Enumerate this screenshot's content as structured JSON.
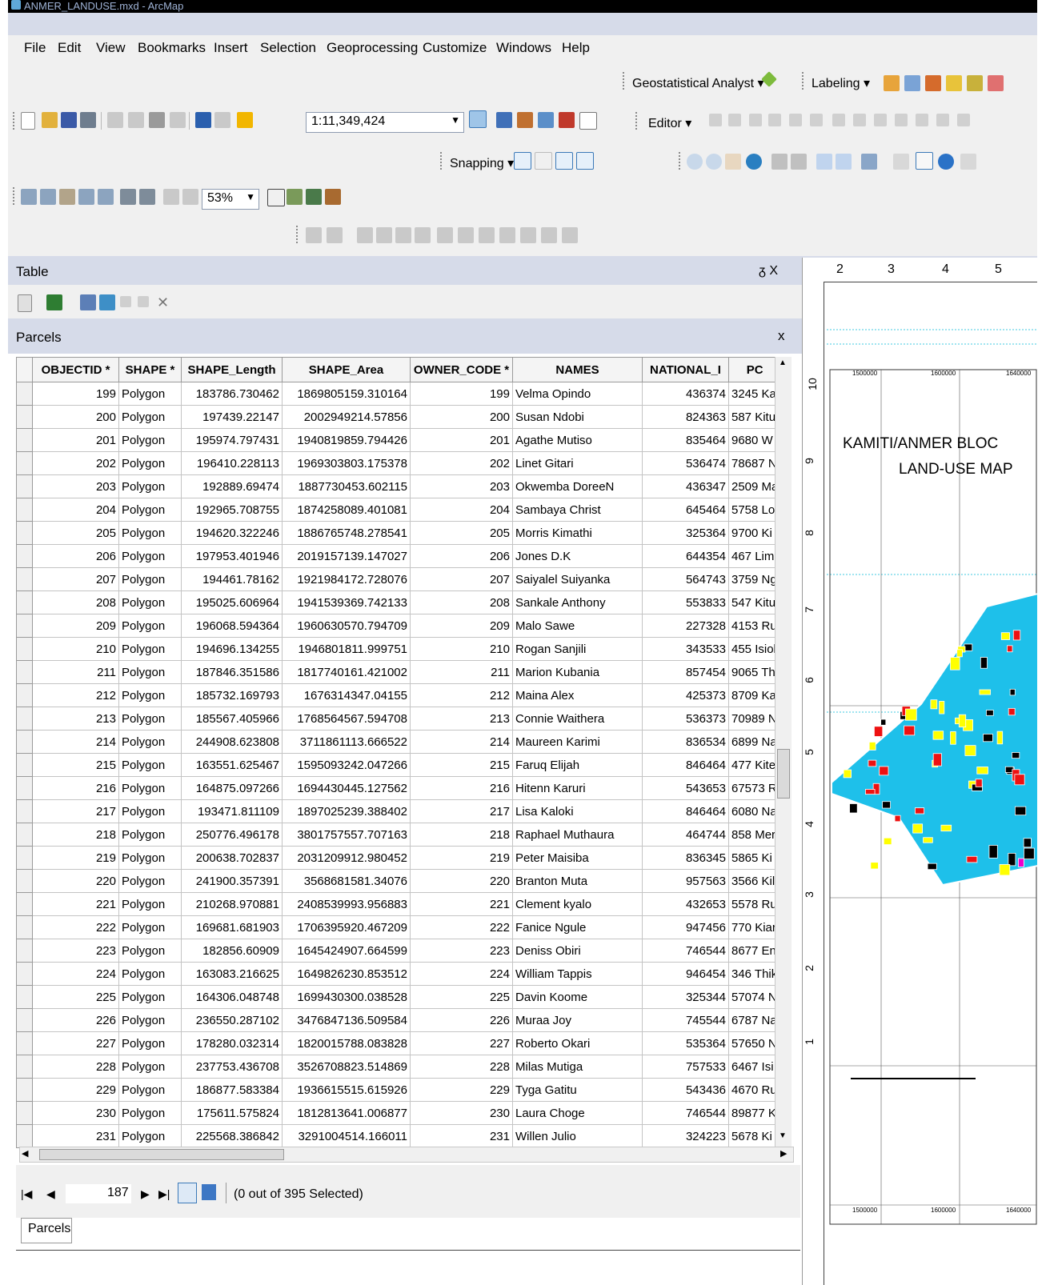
{
  "window": {
    "title": "ANMER_LANDUSE.mxd - ArcMap"
  },
  "menu": [
    "File",
    "Edit",
    "View",
    "Bookmarks",
    "Insert",
    "Selection",
    "Geoprocessing",
    "Customize",
    "Windows",
    "Help"
  ],
  "toolbars": {
    "geostat_label": "Geostatistical Analyst ▾",
    "labeling_label": "Labeling ▾",
    "scale_value": "1:11,349,424",
    "editor_label": "Editor ▾",
    "snapping_label": "Snapping ▾",
    "layout_zoom": "53%"
  },
  "table_panel": {
    "title": "Table",
    "pin": "ᵹ X",
    "tab_title": "Parcels",
    "close": "x"
  },
  "columns": [
    "",
    "OBJECTID *",
    "SHAPE *",
    "SHAPE_Length",
    "SHAPE_Area",
    "OWNER_CODE *",
    "NAMES",
    "NATIONAL_I",
    "PC"
  ],
  "rows": [
    [
      "199",
      "Polygon",
      "183786.730462",
      "1869805159.310164",
      "199",
      "Velma Opindo",
      "436374",
      "3245 Ka"
    ],
    [
      "200",
      "Polygon",
      "197439.22147",
      "2002949214.57856",
      "200",
      "Susan Ndobi",
      "824363",
      "587 Kitu"
    ],
    [
      "201",
      "Polygon",
      "195974.797431",
      "1940819859.794426",
      "201",
      "Agathe Mutiso",
      "835464",
      "9680 W"
    ],
    [
      "202",
      "Polygon",
      "196410.228113",
      "1969303803.175378",
      "202",
      "Linet Gitari",
      "536474",
      "78687 N"
    ],
    [
      "203",
      "Polygon",
      "192889.69474",
      "1887730453.602115",
      "203",
      "Okwemba DoreeN",
      "436347",
      "2509 Ma"
    ],
    [
      "204",
      "Polygon",
      "192965.708755",
      "1874258089.401081",
      "204",
      "Sambaya Christ",
      "645464",
      "5758 Lo"
    ],
    [
      "205",
      "Polygon",
      "194620.322246",
      "1886765748.278541",
      "205",
      "Morris Kimathi",
      "325364",
      "9700 Ki"
    ],
    [
      "206",
      "Polygon",
      "197953.401946",
      "2019157139.147027",
      "206",
      "Jones D.K",
      "644354",
      "467 Lim"
    ],
    [
      "207",
      "Polygon",
      "194461.78162",
      "1921984172.728076",
      "207",
      "Saiyalel Suiyanka",
      "564743",
      "3759 Ng"
    ],
    [
      "208",
      "Polygon",
      "195025.606964",
      "1941539369.742133",
      "208",
      "Sankale Anthony",
      "553833",
      "547 Kitu"
    ],
    [
      "209",
      "Polygon",
      "196068.594364",
      "1960630570.794709",
      "209",
      "Malo Sawe",
      "227328",
      "4153 Ru"
    ],
    [
      "210",
      "Polygon",
      "194696.134255",
      "1946801811.999751",
      "210",
      "Rogan Sanjili",
      "343533",
      "455 Isiol"
    ],
    [
      "211",
      "Polygon",
      "187846.351586",
      "1817740161.421002",
      "211",
      "Marion Kubania",
      "857454",
      "9065 Th"
    ],
    [
      "212",
      "Polygon",
      "185732.169793",
      "1676314347.04155",
      "212",
      "Maina Alex",
      "425373",
      "8709 Ka"
    ],
    [
      "213",
      "Polygon",
      "185567.405966",
      "1768564567.594708",
      "213",
      "Connie Waithera",
      "536373",
      "70989 N"
    ],
    [
      "214",
      "Polygon",
      "244908.623808",
      "3711861113.666522",
      "214",
      "Maureen Karimi",
      "836534",
      "6899 Na"
    ],
    [
      "215",
      "Polygon",
      "163551.625467",
      "1595093242.047266",
      "215",
      "Faruq Elijah",
      "846464",
      "477 Kite"
    ],
    [
      "216",
      "Polygon",
      "164875.097266",
      "1694430445.127562",
      "216",
      "Hitenn Karuri",
      "543653",
      "67573 R"
    ],
    [
      "217",
      "Polygon",
      "193471.811109",
      "1897025239.388402",
      "217",
      "Lisa Kaloki",
      "846464",
      "6080 Na"
    ],
    [
      "218",
      "Polygon",
      "250776.496178",
      "3801757557.707163",
      "218",
      "Raphael Muthaura",
      "464744",
      "858 Mer"
    ],
    [
      "219",
      "Polygon",
      "200638.702837",
      "2031209912.980452",
      "219",
      "Peter Maisiba",
      "836345",
      "5865 Ki"
    ],
    [
      "220",
      "Polygon",
      "241900.357391",
      "3568681581.34076",
      "220",
      "Branton Muta",
      "957563",
      "3566 Kil"
    ],
    [
      "221",
      "Polygon",
      "210268.970881",
      "2408539993.956883",
      "221",
      "Clement kyalo",
      "432653",
      "5578 Ru"
    ],
    [
      "222",
      "Polygon",
      "169681.681903",
      "1706395920.467209",
      "222",
      "Fanice Ngule",
      "947456",
      "770 Kiar"
    ],
    [
      "223",
      "Polygon",
      "182856.60909",
      "1645424907.664599",
      "223",
      "Deniss Obiri",
      "746544",
      "8677 En"
    ],
    [
      "224",
      "Polygon",
      "163083.216625",
      "1649826230.853512",
      "224",
      "William Tappis",
      "946454",
      "346 Thik"
    ],
    [
      "225",
      "Polygon",
      "164306.048748",
      "1699430300.038528",
      "225",
      "Davin Koome",
      "325344",
      "57074 N"
    ],
    [
      "226",
      "Polygon",
      "236550.287102",
      "3476847136.509584",
      "226",
      "Muraa Joy",
      "745544",
      "6787 Na"
    ],
    [
      "227",
      "Polygon",
      "178280.032314",
      "1820015788.083828",
      "227",
      "Roberto Okari",
      "535364",
      "57650 N"
    ],
    [
      "228",
      "Polygon",
      "237753.436708",
      "3526708823.514869",
      "228",
      "Milas Mutiga",
      "757533",
      "6467 Isi"
    ],
    [
      "229",
      "Polygon",
      "186877.583384",
      "1936615515.615926",
      "229",
      "Tyga Gatitu",
      "543436",
      "4670 Ru"
    ],
    [
      "230",
      "Polygon",
      "175611.575824",
      "1812813641.006877",
      "230",
      "Laura Choge",
      "746544",
      "89877 K"
    ],
    [
      "231",
      "Polygon",
      "225568.386842",
      "3291004514.166011",
      "231",
      "Willen Julio",
      "324223",
      "5678 Ki"
    ]
  ],
  "navigation": {
    "record": "187",
    "status": "(0 out of 395 Selected)",
    "bottom_tab": "Parcels"
  },
  "map": {
    "title_line1": "KAMITI/ANMER BLOC",
    "title_line2": "LAND-USE MAP",
    "ruler_top": [
      "2",
      "3",
      "4",
      "5"
    ],
    "ruler_left": [
      "10",
      "9",
      "8",
      "7",
      "6",
      "5",
      "4",
      "3",
      "2",
      "1"
    ],
    "grid_top_labels": [
      "1500000",
      "1600000",
      "1640000"
    ],
    "grid_bottom_labels": [
      "1500000",
      "1600000",
      "1640000"
    ]
  },
  "colors": {
    "parcel_fill": "#1ec0ea",
    "residential": "#ee1111",
    "commercial": "#ffff00",
    "industrial": "#000000",
    "other": "#ee00cc"
  }
}
